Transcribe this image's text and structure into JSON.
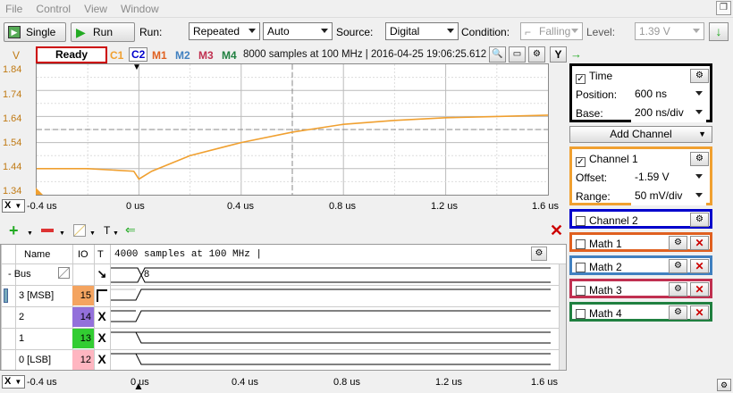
{
  "menu": [
    "File",
    "Control",
    "View",
    "Window"
  ],
  "toolbar": {
    "single": "Single",
    "run": "Run",
    "run_label": "Run:",
    "run_mode": "Repeated",
    "auto": "Auto",
    "source_label": "Source:",
    "source": "Digital",
    "condition_label": "Condition:",
    "condition": "Falling",
    "level_label": "Level:",
    "level": "1.39 V"
  },
  "status": {
    "ready": "Ready",
    "tags": [
      "C1",
      "C2",
      "M1",
      "M2",
      "M3",
      "M4"
    ],
    "info": "8000 samples at 100 MHz | 2016-04-25 19:06:25.612",
    "y_btn": "Y"
  },
  "chart_data": {
    "type": "line",
    "ylabel": "V",
    "yticks": [
      "1.84",
      "1.74",
      "1.64",
      "1.54",
      "1.44",
      "1.34"
    ],
    "ylim": [
      1.34,
      1.84
    ],
    "xticks": [
      "-0.4 us",
      "0 us",
      "0.4 us",
      "0.8 us",
      "1.2 us",
      "1.6 us"
    ],
    "xlim": [
      -0.4,
      1.6
    ],
    "grid": true,
    "series": [
      {
        "color": "#f0a030",
        "x": [
          -0.4,
          -0.2,
          -0.02,
          0.0,
          0.05,
          0.2,
          0.4,
          0.6,
          0.8,
          1.0,
          1.2,
          1.4,
          1.6
        ],
        "y": [
          1.44,
          1.44,
          1.43,
          1.4,
          1.43,
          1.49,
          1.54,
          1.58,
          1.61,
          1.625,
          1.635,
          1.64,
          1.645
        ]
      }
    ]
  },
  "x_axis": {
    "label": "X",
    "ticks": [
      "-0.4 us",
      "0 us",
      "0.4 us",
      "0.8 us",
      "1.2 us",
      "1.6 us"
    ]
  },
  "digital": {
    "header": {
      "name": "Name",
      "io": "IO",
      "t": "T",
      "info": "4000 samples at 100 MHz |"
    },
    "rows": [
      {
        "name": "- Bus",
        "io": "",
        "t": "↘",
        "value": "8"
      },
      {
        "name": "3 [MSB]",
        "io": "15",
        "t": "",
        "color": "#f4a460"
      },
      {
        "name": "2",
        "io": "14",
        "t": "X",
        "color": "#9370db"
      },
      {
        "name": "1",
        "io": "13",
        "t": "X",
        "color": "#32cd32"
      },
      {
        "name": "0 [LSB]",
        "io": "12",
        "t": "X",
        "color": "#ffb6c1"
      }
    ]
  },
  "right": {
    "time": {
      "label": "Time",
      "position_label": "Position:",
      "position": "600 ns",
      "base_label": "Base:",
      "base": "200 ns/div"
    },
    "add_channel": "Add Channel",
    "channel1": {
      "label": "Channel 1",
      "offset_label": "Offset:",
      "offset": "-1.59 V",
      "range_label": "Range:",
      "range": "50 mV/div"
    },
    "channel2": "Channel 2",
    "math": [
      "Math 1",
      "Math 2",
      "Math 3",
      "Math 4"
    ],
    "colors": {
      "time": "#000000",
      "channel1": "#f0a030",
      "channel2": "#0000cc",
      "math1": "#e06020",
      "math2": "#4080c0",
      "math3": "#c03050",
      "math4": "#208040"
    }
  }
}
